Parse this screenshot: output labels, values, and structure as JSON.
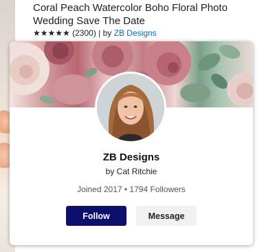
{
  "product": {
    "title": "Coral Peach Watercolor Boho Floral Photo Wedding Save The Date",
    "stars": "★★★★★",
    "review_count": "(2300)",
    "separator": "| by",
    "store_link": "ZB Designs",
    "rating": 5
  },
  "profile": {
    "store_name": "ZB Designs",
    "byline": "by Cat Ritchie",
    "stats": "Joined 2017 • 1794 Followers",
    "follow_label": "Follow",
    "message_label": "Message"
  },
  "colors": {
    "follow_button": "#0c0f6b",
    "link": "#0b66c3",
    "message_button": "#f1f1f2"
  }
}
